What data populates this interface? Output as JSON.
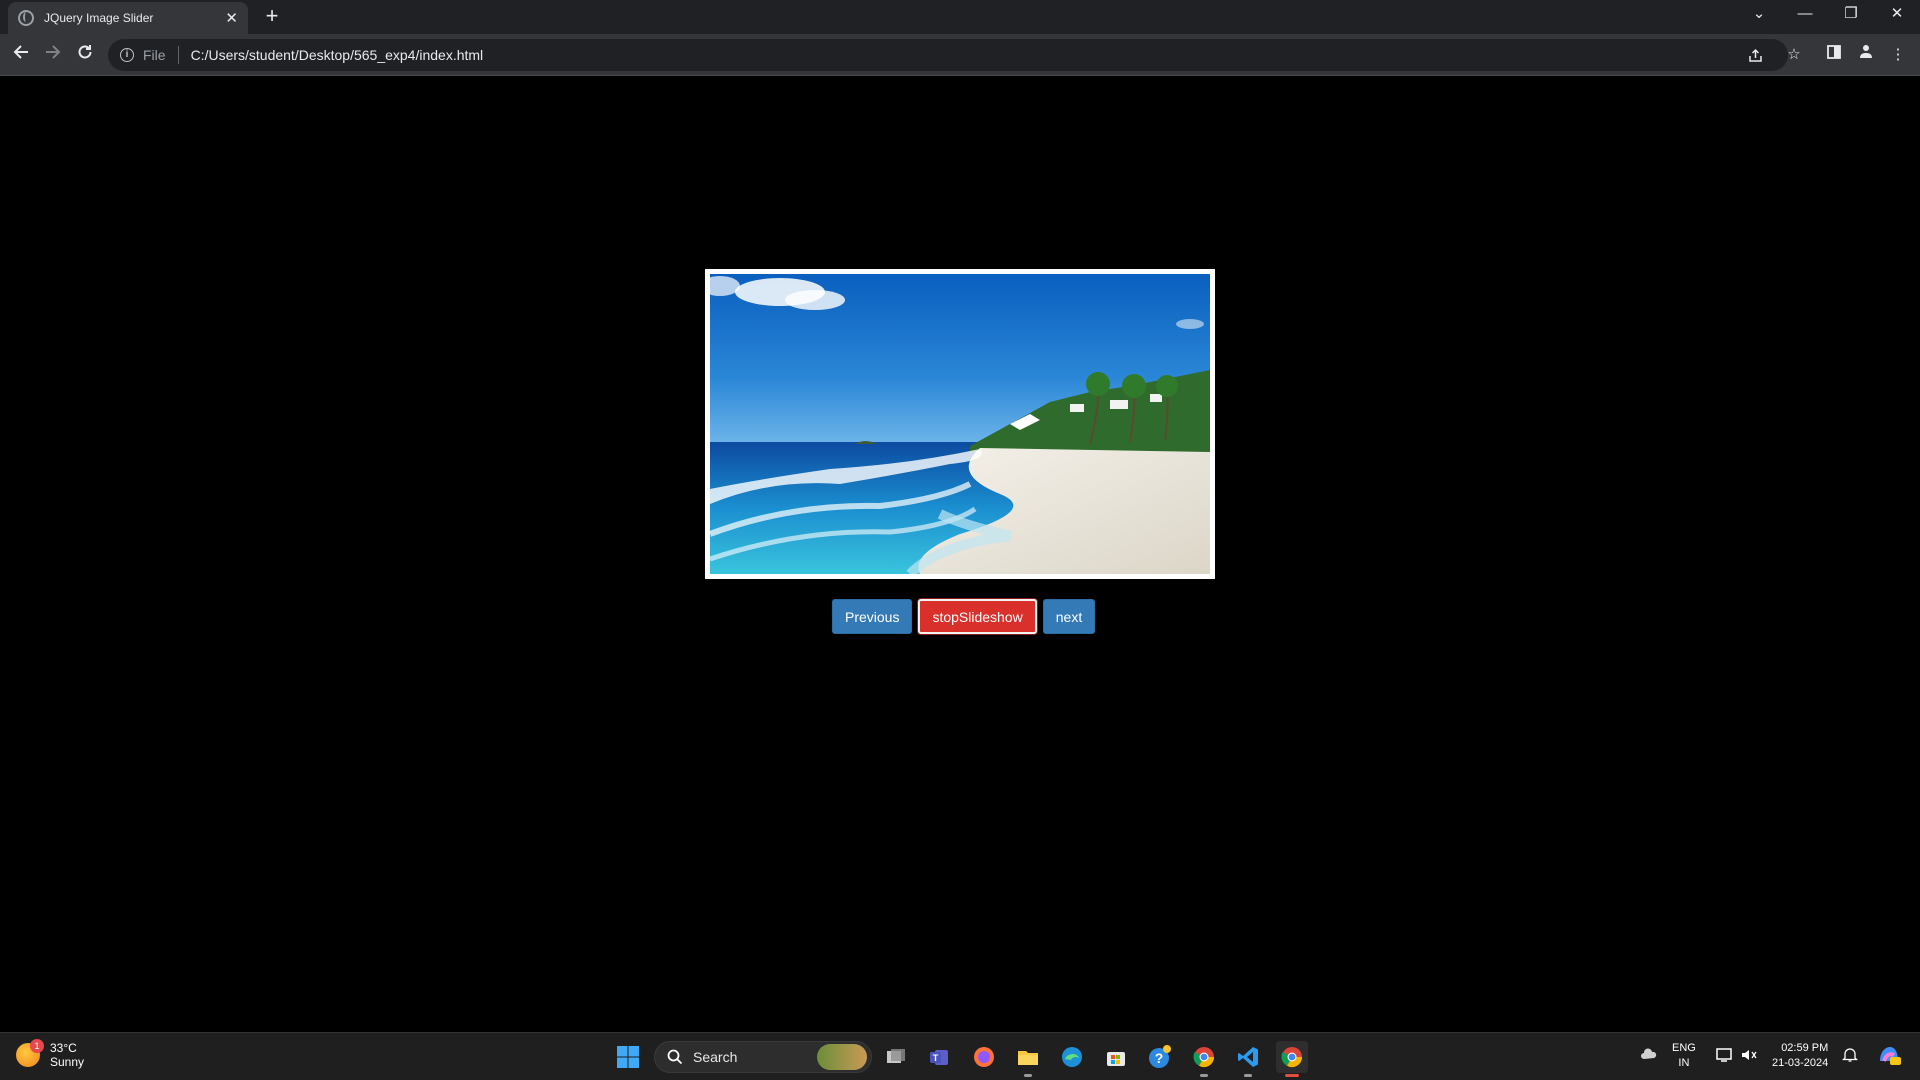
{
  "browser": {
    "tab_title": "JQuery Image Slider",
    "new_tab_symbol": "+",
    "tab_close_symbol": "✕",
    "omnibox": {
      "scheme_label": "File",
      "url": "C:/Users/student/Desktop/565_exp4/index.html"
    },
    "window_controls": {
      "tab_search": "⌄",
      "minimize": "—",
      "restore": "❐",
      "close": "✕"
    },
    "icons": [
      "back-icon",
      "forward-icon",
      "reload-icon",
      "info-icon",
      "share-icon",
      "star-icon",
      "side-panel-icon",
      "profile-icon",
      "menu-icon"
    ]
  },
  "page": {
    "background": "#000000",
    "slide": {
      "description_icon": "beach-photo",
      "frame_color": "#ffffff"
    },
    "buttons": {
      "previous": "Previous",
      "stop": "stopSlideshow",
      "next": "next"
    },
    "colors": {
      "primary": "#337ab7",
      "danger": "#d9302b"
    }
  },
  "taskbar": {
    "weather": {
      "temperature": "33°C",
      "condition": "Sunny",
      "badge": "1"
    },
    "search_placeholder": "Search",
    "apps": [
      "windows-start-icon",
      "search-icon",
      "task-view-icon",
      "teams-icon",
      "firefox-icon",
      "file-explorer-icon",
      "edge-icon",
      "store-icon",
      "help-icon",
      "chrome-icon",
      "vscode-icon",
      "chrome-active-icon"
    ],
    "tray": {
      "language_top": "ENG",
      "language_bottom": "IN",
      "time": "02:59 PM",
      "date": "21-03-2024"
    }
  }
}
